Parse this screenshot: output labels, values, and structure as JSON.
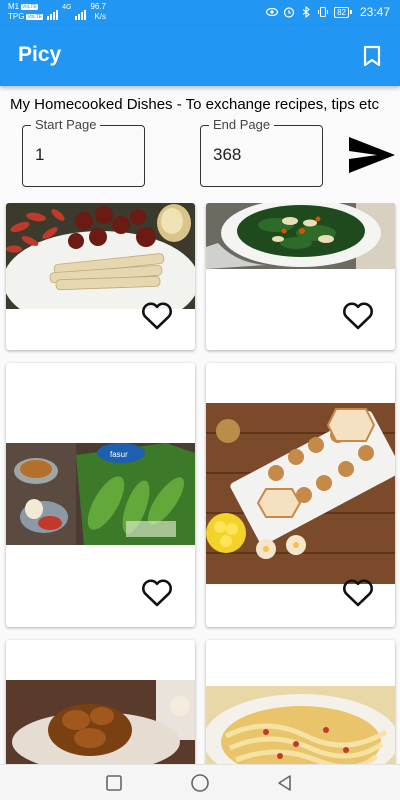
{
  "status_bar": {
    "carrier1": "M1",
    "carrier1_tag": "VoLTE",
    "carrier2": "TPG",
    "carrier2_tag": "VoLTE",
    "network": "4G",
    "net_speed": "96.7",
    "net_speed_unit": "K/s",
    "battery": "82",
    "time": "23:47",
    "icons": [
      "eye-icon",
      "alarm-icon",
      "bluetooth-icon",
      "vibrate-icon",
      "battery-icon"
    ]
  },
  "app_bar": {
    "title": "Picy",
    "action_icon": "bookmark-icon"
  },
  "subtitle": "My Homecooked Dishes - To exchange recipes, tips etc",
  "form": {
    "start_label": "Start Page",
    "start_value": "1",
    "end_label": "End Page",
    "end_value": "368",
    "submit_icon": "send-icon"
  },
  "grid": {
    "cards": [
      {
        "name": "card-goji-dried-herbs",
        "icon": "heart-outline-icon"
      },
      {
        "name": "card-spinach-egg-soup",
        "icon": "heart-outline-icon"
      },
      {
        "name": "card-spinach-groceries",
        "icon": "heart-outline-icon"
      },
      {
        "name": "card-spoon-canapes",
        "icon": "heart-outline-icon"
      },
      {
        "name": "card-braised-meat",
        "icon": "heart-outline-icon"
      },
      {
        "name": "card-noodle-dish",
        "icon": "heart-outline-icon"
      }
    ]
  },
  "colors": {
    "primary": "#2196f3",
    "background": "#fafafa",
    "card": "#ffffff",
    "text": "#000000"
  },
  "nav_bar": {
    "icons": [
      "recents-square-icon",
      "home-circle-icon",
      "back-triangle-icon"
    ]
  }
}
